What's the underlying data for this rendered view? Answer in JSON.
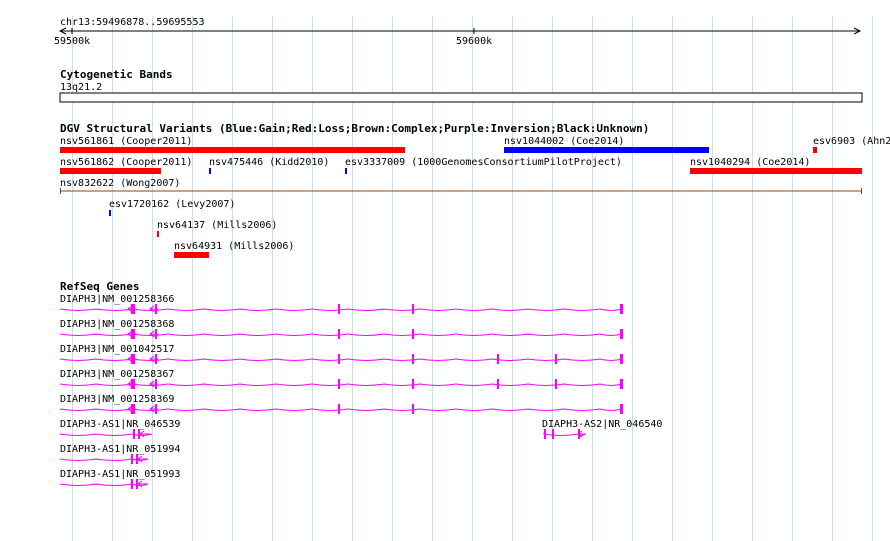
{
  "ruler": {
    "position": "chr13:59496878..59695553",
    "ticks": [
      "59500k",
      "59600k"
    ]
  },
  "tracks": {
    "cytoband": {
      "title": "Cytogenetic Bands",
      "band": "13q21.2"
    },
    "dgv": {
      "title": "DGV Structural Variants (Blue:Gain;Red:Loss;Brown:Complex;Purple:Inversion;Black:Unknown)",
      "features": [
        {
          "label": "nsv561861 (Cooper2011)",
          "type": "Loss"
        },
        {
          "label": "nsv1044002 (Coe2014)",
          "type": "Gain"
        },
        {
          "label": "esv6903 (Ahn2",
          "type": "Loss"
        },
        {
          "label": "nsv561862 (Cooper2011)",
          "type": "Loss"
        },
        {
          "label": "nsv475446 (Kidd2010)",
          "type": "Gain"
        },
        {
          "label": "esv3337009 (1000GenomesConsortiumPilotProject)",
          "type": "Gain"
        },
        {
          "label": "nsv1040294 (Coe2014)",
          "type": "Loss"
        },
        {
          "label": "nsv832622 (Wong2007)",
          "type": "Complex"
        },
        {
          "label": "esv1720162 (Levy2007)",
          "type": "Gain"
        },
        {
          "label": "nsv64137 (Mills2006)",
          "type": "Loss"
        },
        {
          "label": "nsv64931 (Mills2006)",
          "type": "Loss"
        }
      ]
    },
    "refseq": {
      "title": "RefSeq Genes",
      "transcripts": [
        "DIAPH3|NM_001258366",
        "DIAPH3|NM_001258368",
        "DIAPH3|NM_001042517",
        "DIAPH3|NM_001258367",
        "DIAPH3|NM_001258369",
        "DIAPH3-AS1|NR_046539",
        "DIAPH3-AS2|NR_046540",
        "DIAPH3-AS1|NR_051994",
        "DIAPH3-AS1|NR_051993"
      ]
    }
  },
  "colors": {
    "grid": "#bde3f2",
    "gain": "#0000ff",
    "loss": "#ff0000",
    "complex": "#8b4513",
    "gene": "#ff00ff",
    "text": "#000000"
  }
}
